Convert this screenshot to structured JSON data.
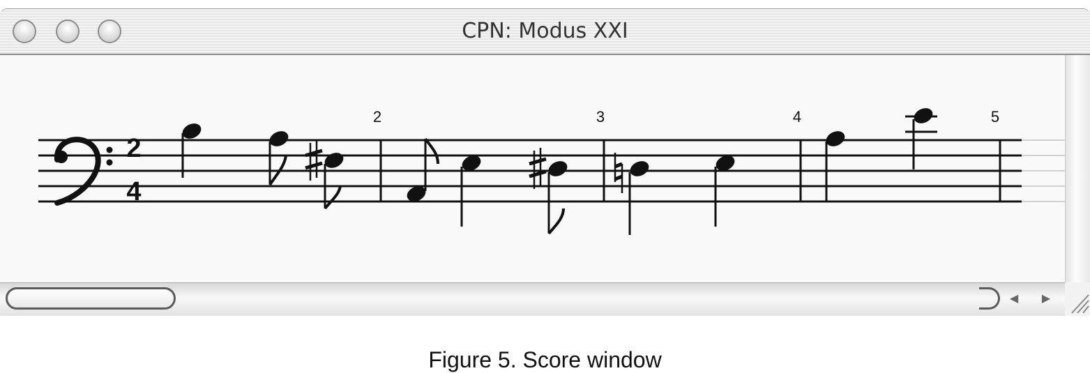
{
  "window": {
    "title": "CPN: Modus XXI",
    "controls": [
      "close",
      "minimize",
      "zoom"
    ]
  },
  "score": {
    "clef": "bass-clef-icon",
    "time_signature": {
      "numerator": "2",
      "denominator": "4"
    },
    "measure_numbers": [
      "2",
      "3",
      "4",
      "5"
    ]
  },
  "scrollbar": {
    "left_arrow": "◀",
    "right_arrow": "▶"
  },
  "caption": "Figure 5. Score window"
}
